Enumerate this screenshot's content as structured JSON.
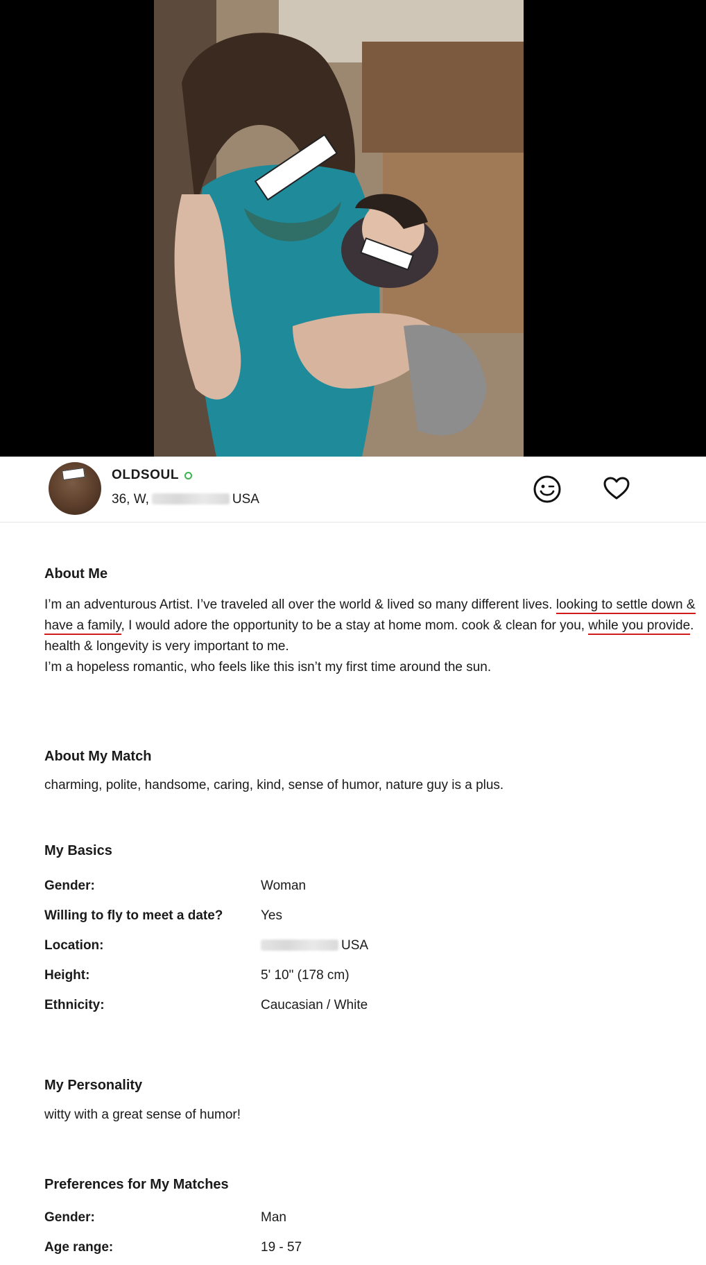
{
  "profile": {
    "username": "OLDSOUL",
    "age_gender": "36, W,",
    "country": "USA",
    "status_color": "#3bb54a"
  },
  "actions": {
    "wink_icon": "wink-smiley-icon",
    "favorite_icon": "heart-outline-icon"
  },
  "about_me": {
    "title": "About Me",
    "text_part1": "I’m an adventurous Artist. I’ve traveled all over the world & lived so many different lives.",
    "underlined_1": "looking to settle down & have a family",
    "text_part2": ", I would adore the opportunity to be a stay at home mom. cook & clean for you,",
    "underlined_2": "while you provide",
    "text_part3": ".",
    "line2": "health & longevity is very important to me.",
    "line3": "I’m a hopeless romantic, who feels like this isn’t my first time around the sun."
  },
  "about_match": {
    "title": "About My Match",
    "text": "charming, polite, handsome, caring, kind, sense of humor, nature guy is a plus."
  },
  "basics": {
    "title": "My Basics",
    "rows": [
      {
        "label": "Gender:",
        "value": "Woman"
      },
      {
        "label": "Willing to fly to meet a date?",
        "value": "Yes"
      },
      {
        "label": "Location:",
        "value": "USA"
      },
      {
        "label": "Height:",
        "value": "5' 10\" (178 cm)"
      },
      {
        "label": "Ethnicity:",
        "value": "Caucasian / White"
      }
    ]
  },
  "personality": {
    "title": "My Personality",
    "text": "witty with a great sense of humor!"
  },
  "preferences": {
    "title": "Preferences for My Matches",
    "rows": [
      {
        "label": "Gender:",
        "value": "Man"
      },
      {
        "label": "Age range:",
        "value": "19 - 57"
      }
    ]
  },
  "colors": {
    "underline": "#d11a1a",
    "divider": "#e6e6e6"
  }
}
